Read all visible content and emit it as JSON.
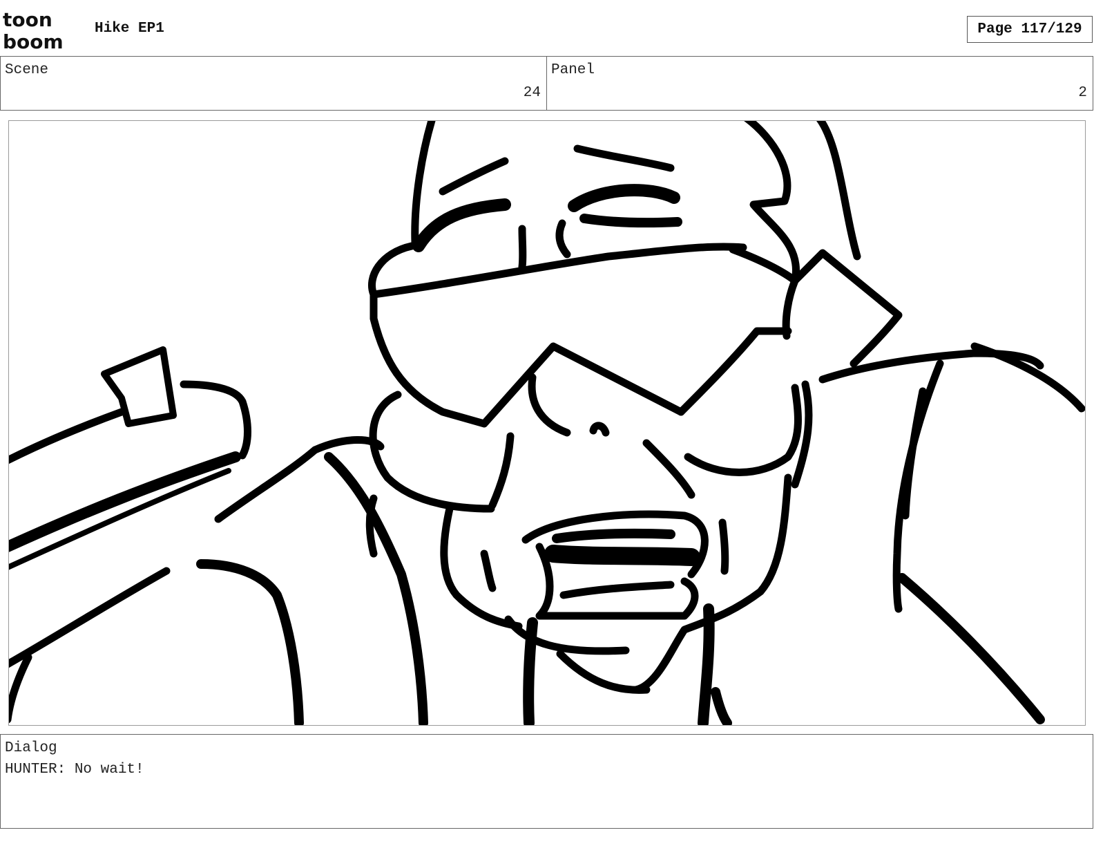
{
  "header": {
    "logo": {
      "line1": "toon",
      "line2": "boom"
    },
    "project_title": "Hike EP1",
    "page_indicator": "Page 117/129"
  },
  "info": {
    "scene_label": "Scene",
    "scene_value": "24",
    "panel_label": "Panel",
    "panel_value": "2"
  },
  "dialog": {
    "label": "Dialog",
    "text": "HUNTER: No wait!"
  }
}
